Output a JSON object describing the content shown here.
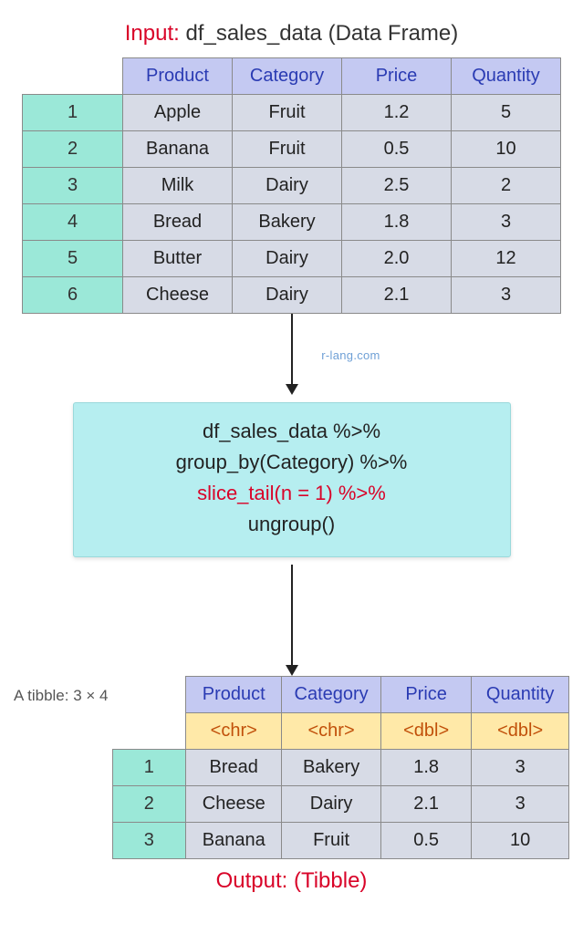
{
  "titles": {
    "input_label": "Input:",
    "input_rest": "df_sales_data (Data Frame)",
    "output_label": "Output:",
    "output_rest": "(Tibble)"
  },
  "watermark": "r-lang.com",
  "columns": [
    "Product",
    "Category",
    "Price",
    "Quantity"
  ],
  "input_rows": [
    {
      "n": "1",
      "cells": [
        "Apple",
        "Fruit",
        "1.2",
        "5"
      ]
    },
    {
      "n": "2",
      "cells": [
        "Banana",
        "Fruit",
        "0.5",
        "10"
      ]
    },
    {
      "n": "3",
      "cells": [
        "Milk",
        "Dairy",
        "2.5",
        "2"
      ]
    },
    {
      "n": "4",
      "cells": [
        "Bread",
        "Bakery",
        "1.8",
        "3"
      ]
    },
    {
      "n": "5",
      "cells": [
        "Butter",
        "Dairy",
        "2.0",
        "12"
      ]
    },
    {
      "n": "6",
      "cells": [
        "Cheese",
        "Dairy",
        "2.1",
        "3"
      ]
    }
  ],
  "code": {
    "line1": "df_sales_data %>%",
    "line2": "group_by(Category) %>%",
    "line3": "slice_tail(n = 1) %>%",
    "line4": "ungroup()"
  },
  "tibble_label": "A tibble: 3 × 4",
  "output_types": [
    "<chr>",
    "<chr>",
    "<dbl>",
    "<dbl>"
  ],
  "output_rows": [
    {
      "n": "1",
      "cells": [
        "Bread",
        "Bakery",
        "1.8",
        "3"
      ]
    },
    {
      "n": "2",
      "cells": [
        "Cheese",
        "Dairy",
        "2.1",
        "3"
      ]
    },
    {
      "n": "3",
      "cells": [
        "Banana",
        "Fruit",
        "0.5",
        "10"
      ]
    }
  ]
}
